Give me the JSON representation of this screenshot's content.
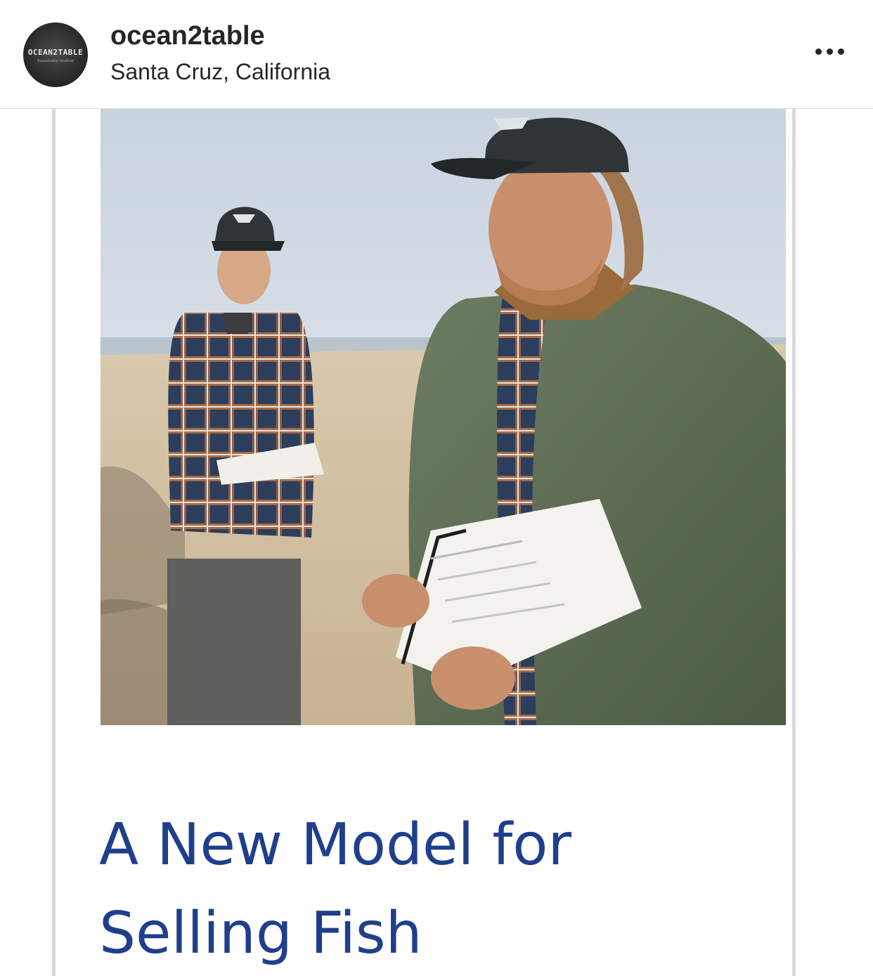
{
  "post_header": {
    "username": "ocean2table",
    "location": "Santa Cruz, California",
    "avatar_logo_text": "OCEAN2TABLE",
    "avatar_logo_subtext": "Sustainable Seafood",
    "more_icon": "more-horizontal-icon"
  },
  "post_content": {
    "headline": "A New Model for Selling Fish",
    "photo_subject": "two-men-on-beach-with-clipboards"
  },
  "colors": {
    "headline": "#1f3f8c",
    "text": "#262626",
    "divider": "#dbdbdb",
    "card_border": "#d9d9d9"
  }
}
